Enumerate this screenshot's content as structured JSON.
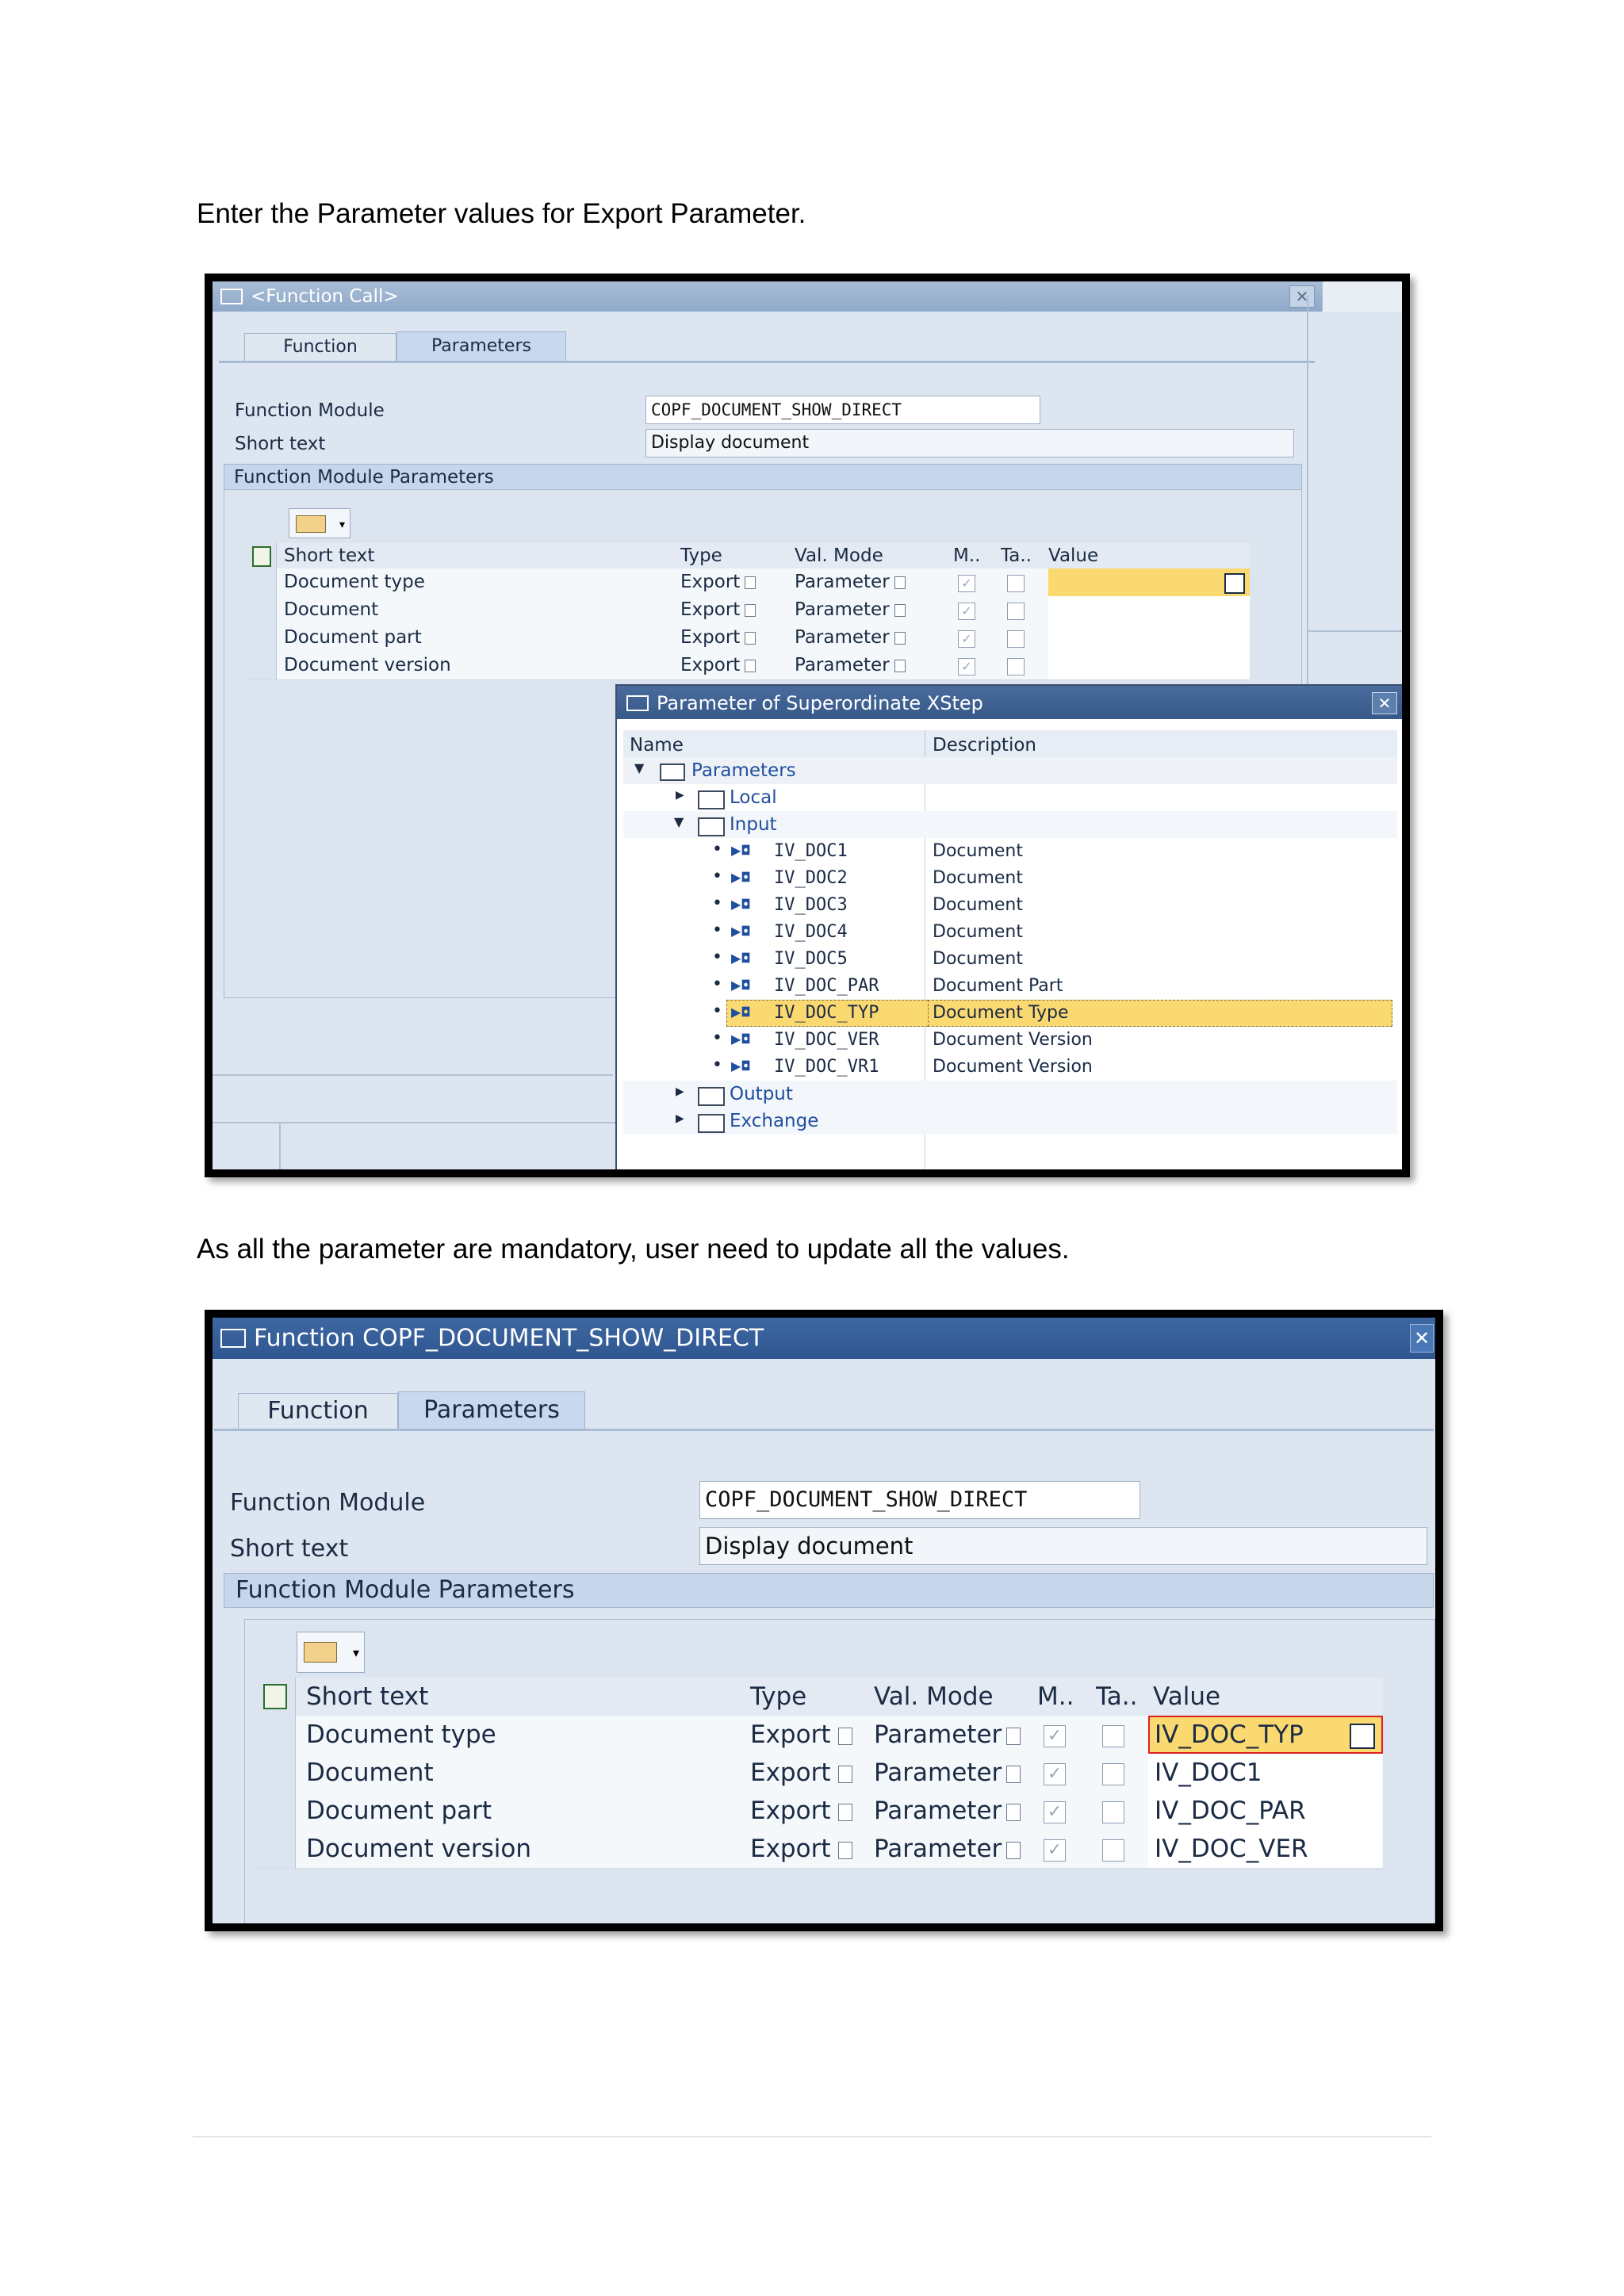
{
  "paragraphs": {
    "p1": "Enter the Parameter values for Export Parameter.",
    "p2": "As all the parameter are mandatory, user need to update all the values."
  },
  "shot1": {
    "title": "<Function Call>",
    "tabs": [
      "Function",
      "Parameters"
    ],
    "function_module_label": "Function Module",
    "function_module_value": "COPF_DOCUMENT_SHOW_DIRECT",
    "short_text_label": "Short text",
    "short_text_value": "Display document",
    "section_title": "Function Module Parameters",
    "columns": [
      "Short text",
      "Type",
      "Val. Mode",
      "M..",
      "Ta..",
      "Value"
    ],
    "rows": [
      {
        "short_text": "Document type",
        "type": "Export",
        "val_mode": "Parameter",
        "value": ""
      },
      {
        "short_text": "Document",
        "type": "Export",
        "val_mode": "Parameter",
        "value": ""
      },
      {
        "short_text": "Document part",
        "type": "Export",
        "val_mode": "Parameter",
        "value": ""
      },
      {
        "short_text": "Document version",
        "type": "Export",
        "val_mode": "Parameter",
        "value": ""
      }
    ],
    "popup": {
      "title": "Parameter of Superordinate XStep",
      "col_name": "Name",
      "col_desc": "Description",
      "root": "Parameters",
      "local": "Local",
      "input": "Input",
      "items": [
        {
          "name": "IV_DOC1",
          "desc": "Document"
        },
        {
          "name": "IV_DOC2",
          "desc": "Document"
        },
        {
          "name": "IV_DOC3",
          "desc": "Document"
        },
        {
          "name": "IV_DOC4",
          "desc": "Document"
        },
        {
          "name": "IV_DOC5",
          "desc": "Document"
        },
        {
          "name": "IV_DOC_PAR",
          "desc": "Document Part"
        },
        {
          "name": "IV_DOC_TYP",
          "desc": "Document Type"
        },
        {
          "name": "IV_DOC_VER",
          "desc": "Document Version"
        },
        {
          "name": "IV_DOC_VR1",
          "desc": "Document Version"
        }
      ],
      "output": "Output",
      "exchange": "Exchange"
    }
  },
  "shot2": {
    "title": "Function COPF_DOCUMENT_SHOW_DIRECT",
    "tabs": [
      "Function",
      "Parameters"
    ],
    "function_module_label": "Function Module",
    "function_module_value": "COPF_DOCUMENT_SHOW_DIRECT",
    "short_text_label": "Short text",
    "short_text_value": "Display document",
    "section_title": "Function Module Parameters",
    "columns": [
      "Short text",
      "Type",
      "Val. Mode",
      "M..",
      "Ta..",
      "Value"
    ],
    "rows": [
      {
        "short_text": "Document type",
        "type": "Export",
        "val_mode": "Parameter",
        "value": "IV_DOC_TYP"
      },
      {
        "short_text": "Document",
        "type": "Export",
        "val_mode": "Parameter",
        "value": "IV_DOC1"
      },
      {
        "short_text": "Document part",
        "type": "Export",
        "val_mode": "Parameter",
        "value": "IV_DOC_PAR"
      },
      {
        "short_text": "Document version",
        "type": "Export",
        "val_mode": "Parameter",
        "value": "IV_DOC_VER"
      }
    ]
  },
  "icons": [
    "window-icon",
    "close-icon",
    "layout-icon",
    "select-all-icon",
    "dropdown-icon",
    "checkbox-icon",
    "folder-icon",
    "parameter-icon",
    "value-help-icon"
  ],
  "colors": {
    "highlight": "#fbd971",
    "title_bar": "#8ea9c9",
    "popup_title": "#37598a"
  }
}
